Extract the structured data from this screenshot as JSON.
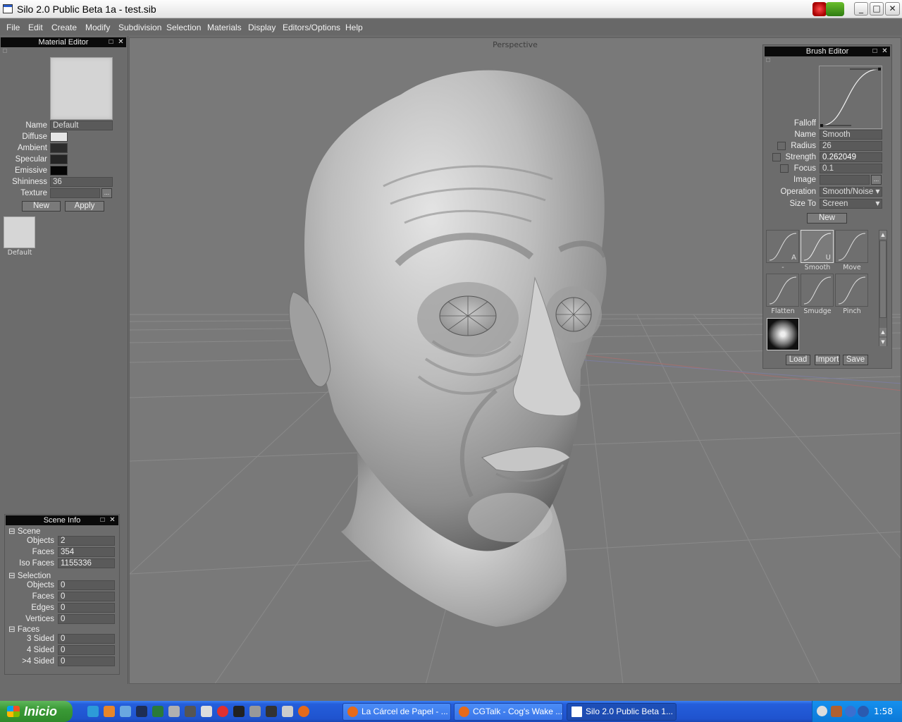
{
  "window": {
    "title": "Silo 2.0 Public Beta 1a - test.sib"
  },
  "menu": [
    "File",
    "Edit",
    "Create",
    "Modify",
    "Subdivision",
    "Selection",
    "Materials",
    "Display",
    "Editors/Options",
    "Help"
  ],
  "material_editor": {
    "title": "Material Editor",
    "name_label": "Name",
    "name_value": "Default",
    "diffuse_label": "Diffuse",
    "diffuse_color": "#e6e6e6",
    "ambient_label": "Ambient",
    "ambient_color": "#2c2c2c",
    "specular_label": "Specular",
    "specular_color": "#242424",
    "emissive_label": "Emissive",
    "emissive_color": "#050505",
    "shininess_label": "Shininess",
    "shininess_value": "36",
    "texture_label": "Texture",
    "texture_value": "",
    "browse_label": "...",
    "new_label": "New",
    "apply_label": "Apply",
    "library_item": "Default"
  },
  "viewport": {
    "label": "Perspective"
  },
  "brush_editor": {
    "title": "Brush Editor",
    "falloff_label": "Falloff",
    "name_label": "Name",
    "name_value": "Smooth",
    "radius_label": "Radius",
    "radius_value": "26",
    "strength_label": "Strength",
    "strength_value": "0.262049",
    "focus_label": "Focus",
    "focus_value": "0.1",
    "image_label": "Image",
    "image_value": "",
    "browse_label": "...",
    "operation_label": "Operation",
    "operation_value": "Smooth/Noise",
    "sizeto_label": "Size To",
    "sizeto_value": "Screen",
    "new_label": "New",
    "brushes": [
      {
        "caption": "-",
        "key": "A"
      },
      {
        "caption": "Smooth",
        "key": "U"
      },
      {
        "caption": "Move",
        "key": ""
      },
      {
        "caption": "Flatten",
        "key": ""
      },
      {
        "caption": "Smudge",
        "key": ""
      },
      {
        "caption": "Pinch",
        "key": ""
      }
    ],
    "load_label": "Load",
    "import_label": "Import",
    "save_label": "Save"
  },
  "scene_info": {
    "title": "Scene Info",
    "scene_label": "Scene",
    "objects_label": "Objects",
    "objects_value": "2",
    "faces_label": "Faces",
    "faces_value": "354",
    "isofaces_label": "Iso Faces",
    "isofaces_value": "1155336",
    "selection_label": "Selection",
    "sel_objects_label": "Objects",
    "sel_objects_value": "0",
    "sel_faces_label": "Faces",
    "sel_faces_value": "0",
    "sel_edges_label": "Edges",
    "sel_edges_value": "0",
    "sel_vertices_label": "Vertices",
    "sel_vertices_value": "0",
    "faces_group_label": "Faces",
    "sided3_label": "3 Sided",
    "sided3_value": "0",
    "sided4_label": "4 Sided",
    "sided4_value": "0",
    "sided_more_label": ">4 Sided",
    "sided_more_value": "0"
  },
  "taskbar": {
    "start_label": "Inicio",
    "tasks": [
      "La Cárcel de Papel - ...",
      "CGTalk - Cog's Wake ...",
      "Silo 2.0 Public Beta 1..."
    ],
    "clock": "1:58"
  }
}
